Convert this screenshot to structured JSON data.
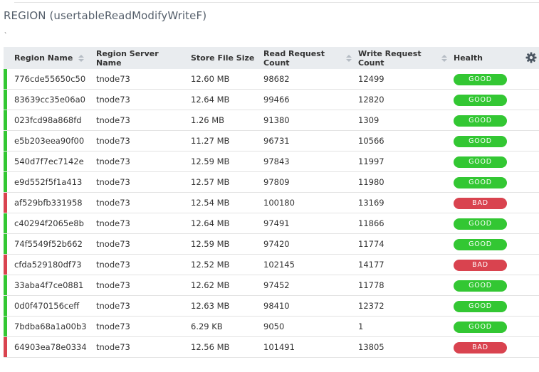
{
  "page": {
    "title": "REGION (usertableReadModifyWriteF)",
    "tick_mark": "`"
  },
  "colors": {
    "good": "#33c733",
    "bad": "#d9434f",
    "header_bg": "#e9ecef"
  },
  "table": {
    "columns": [
      "Region Name",
      "Region Server Name",
      "Store File Size",
      "Read Request Count",
      "Write Request Count",
      "Health"
    ],
    "settings_icon": "gear-icon",
    "rows": [
      [
        "776cde55650c50",
        "tnode73",
        "12.60 MB",
        "98682",
        "12499",
        "GOOD"
      ],
      [
        "83639cc35e06a0",
        "tnode73",
        "12.64 MB",
        "99466",
        "12820",
        "GOOD"
      ],
      [
        "023fcd98a868fd",
        "tnode73",
        "1.26 MB",
        "91380",
        "1309",
        "GOOD"
      ],
      [
        "e5b203eea90f00",
        "tnode73",
        "11.27 MB",
        "96731",
        "10566",
        "GOOD"
      ],
      [
        "540d7f7ec7142e",
        "tnode73",
        "12.59 MB",
        "97843",
        "11997",
        "GOOD"
      ],
      [
        "e9d552f5f1a413",
        "tnode73",
        "12.57 MB",
        "97809",
        "11980",
        "GOOD"
      ],
      [
        "af529bfb331958",
        "tnode73",
        "12.54 MB",
        "100180",
        "13169",
        "BAD"
      ],
      [
        "c40294f2065e8b",
        "tnode73",
        "12.64 MB",
        "97491",
        "11866",
        "GOOD"
      ],
      [
        "74f5549f52b662",
        "tnode73",
        "12.59 MB",
        "97420",
        "11774",
        "GOOD"
      ],
      [
        "cfda529180df73",
        "tnode73",
        "12.52 MB",
        "102145",
        "14177",
        "BAD"
      ],
      [
        "33aba4f7ce0881",
        "tnode73",
        "12.62 MB",
        "97452",
        "11778",
        "GOOD"
      ],
      [
        "0d0f470156ceff",
        "tnode73",
        "12.63 MB",
        "98410",
        "12372",
        "GOOD"
      ],
      [
        "7bdba68a1a00b3",
        "tnode73",
        "6.29 KB",
        "9050",
        "1",
        "GOOD"
      ],
      [
        "64903ea78e0334",
        "tnode73",
        "12.56 MB",
        "101491",
        "13805",
        "BAD"
      ]
    ]
  }
}
